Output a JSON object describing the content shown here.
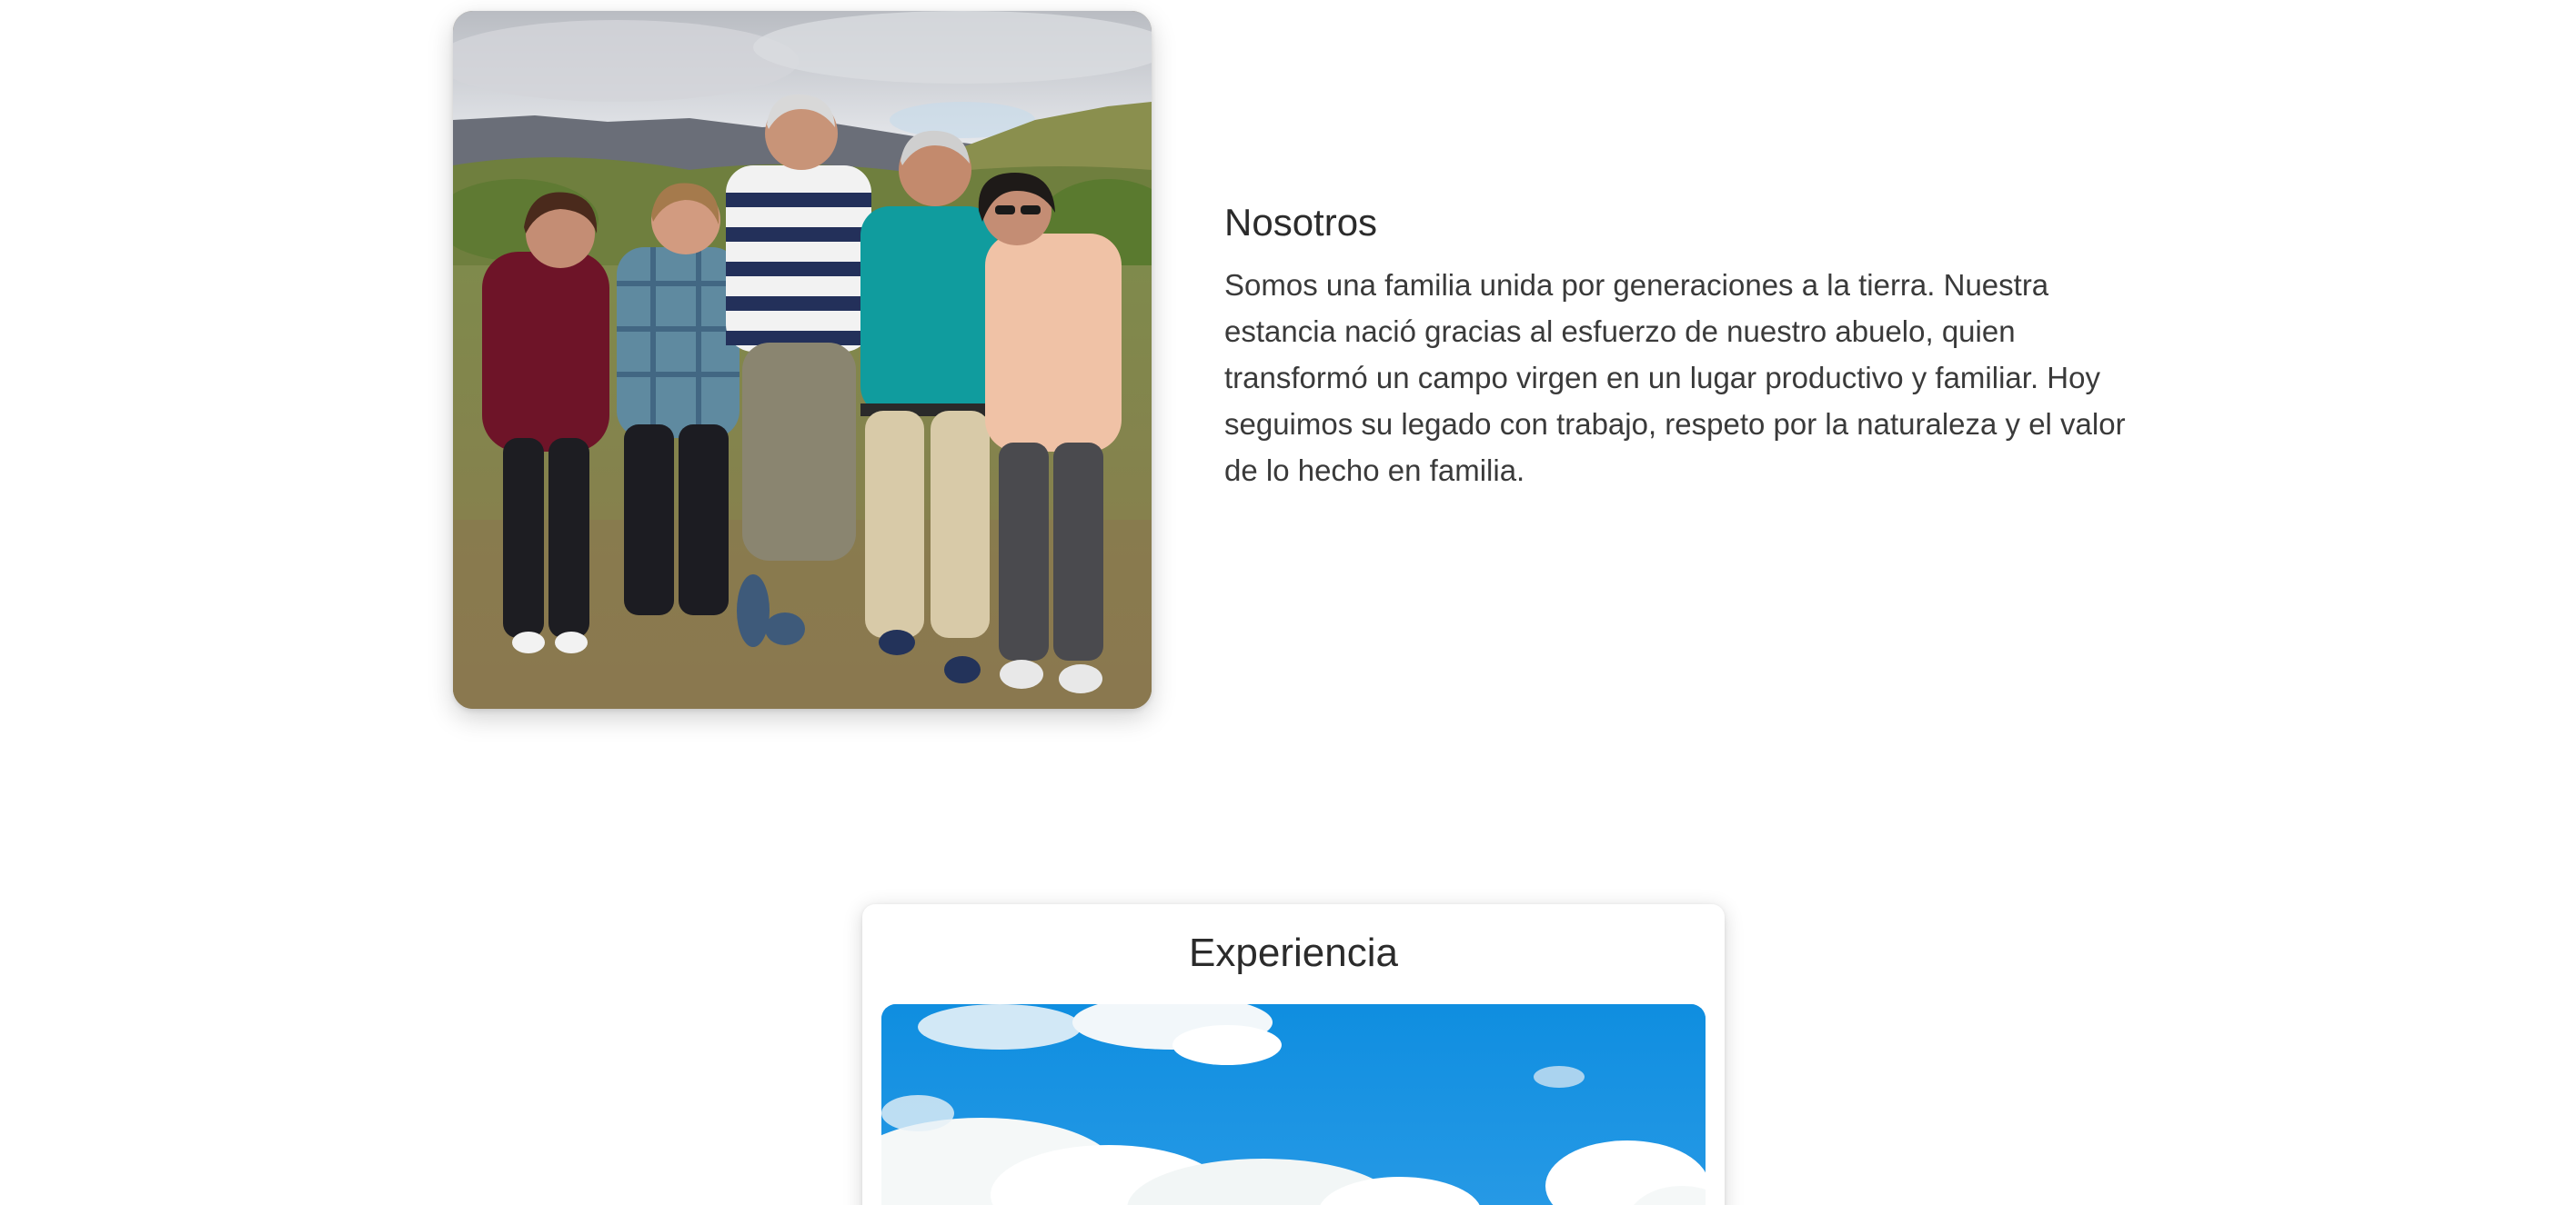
{
  "about": {
    "title": "Nosotros",
    "body": "Somos una familia unida por generaciones a la tierra. Nuestra estancia nació gracias al esfuerzo de nuestro abuelo, quien transformó un campo virgen en un lugar productivo y familiar. Hoy seguimos su legado con trabajo, respeto por la naturaleza y el valor de lo hecho en familia.",
    "photo_subject": "family-group-photo"
  },
  "experience": {
    "title": "Experiencia",
    "photo_subject": "blue-sky-clouds-photo"
  },
  "colors": {
    "background": "#ffffff",
    "text": "#2f2f2f",
    "sky_blue": "#1f8fe0"
  }
}
